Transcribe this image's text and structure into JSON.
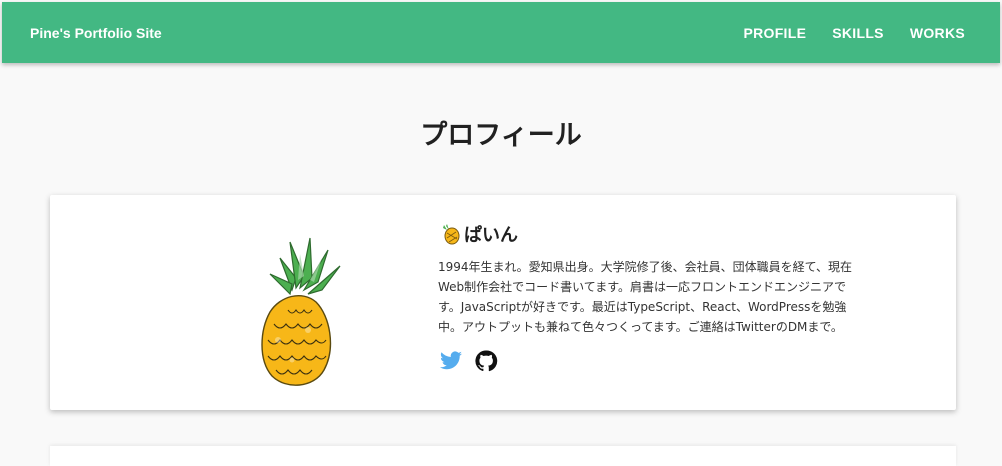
{
  "header": {
    "site_title": "Pine's Portfolio Site",
    "nav": [
      {
        "label": "PROFILE"
      },
      {
        "label": "SKILLS"
      },
      {
        "label": "WORKS"
      }
    ]
  },
  "profile": {
    "heading": "プロフィール",
    "name": "ぱいん",
    "name_icon": "pineapple-icon",
    "bio": "1994年生まれ。愛知県出身。大学院修了後、会社員、団体職員を経て、現在Web制作会社でコード書いてます。肩書は一応フロントエンドエンジニアです。JavaScriptが好きです。最近はTypeScript、React、WordPressを勉強中。アウトプットも兼ねて色々つくってます。ご連絡はTwitterのDMまで。",
    "social": [
      {
        "icon": "twitter-icon",
        "color": "#55acee"
      },
      {
        "icon": "github-icon",
        "color": "#111111"
      }
    ]
  },
  "colors": {
    "accent": "#43b883",
    "background": "#f9f9f9",
    "card": "#ffffff"
  }
}
